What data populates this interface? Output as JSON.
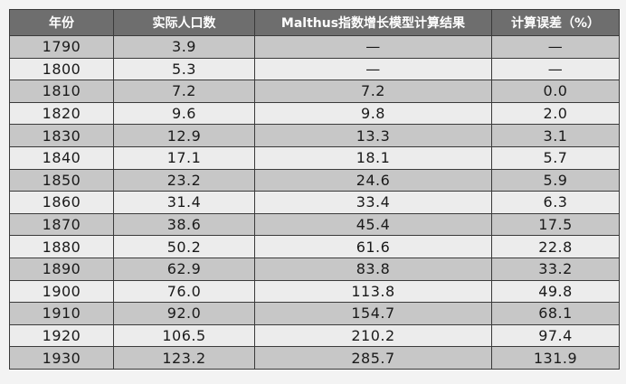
{
  "table": {
    "headers": [
      "年份",
      "实际人口数",
      "Malthus指数增长模型计算结果",
      "计算误差（%）"
    ],
    "rows": [
      [
        "1790",
        "3.9",
        "—",
        "—"
      ],
      [
        "1800",
        "5.3",
        "—",
        "—"
      ],
      [
        "1810",
        "7.2",
        "7.2",
        "0.0"
      ],
      [
        "1820",
        "9.6",
        "9.8",
        "2.0"
      ],
      [
        "1830",
        "12.9",
        "13.3",
        "3.1"
      ],
      [
        "1840",
        "17.1",
        "18.1",
        "5.7"
      ],
      [
        "1850",
        "23.2",
        "24.6",
        "5.9"
      ],
      [
        "1860",
        "31.4",
        "33.4",
        "6.3"
      ],
      [
        "1870",
        "38.6",
        "45.4",
        "17.5"
      ],
      [
        "1880",
        "50.2",
        "61.6",
        "22.8"
      ],
      [
        "1890",
        "62.9",
        "83.8",
        "33.2"
      ],
      [
        "1900",
        "76.0",
        "113.8",
        "49.8"
      ],
      [
        "1910",
        "92.0",
        "154.7",
        "68.1"
      ],
      [
        "1920",
        "106.5",
        "210.2",
        "97.4"
      ],
      [
        "1930",
        "123.2",
        "285.7",
        "131.9"
      ]
    ]
  },
  "colors": {
    "header_bg": "#6e6e6e",
    "row_dark": "#c7c7c7",
    "row_light": "#ececec"
  }
}
